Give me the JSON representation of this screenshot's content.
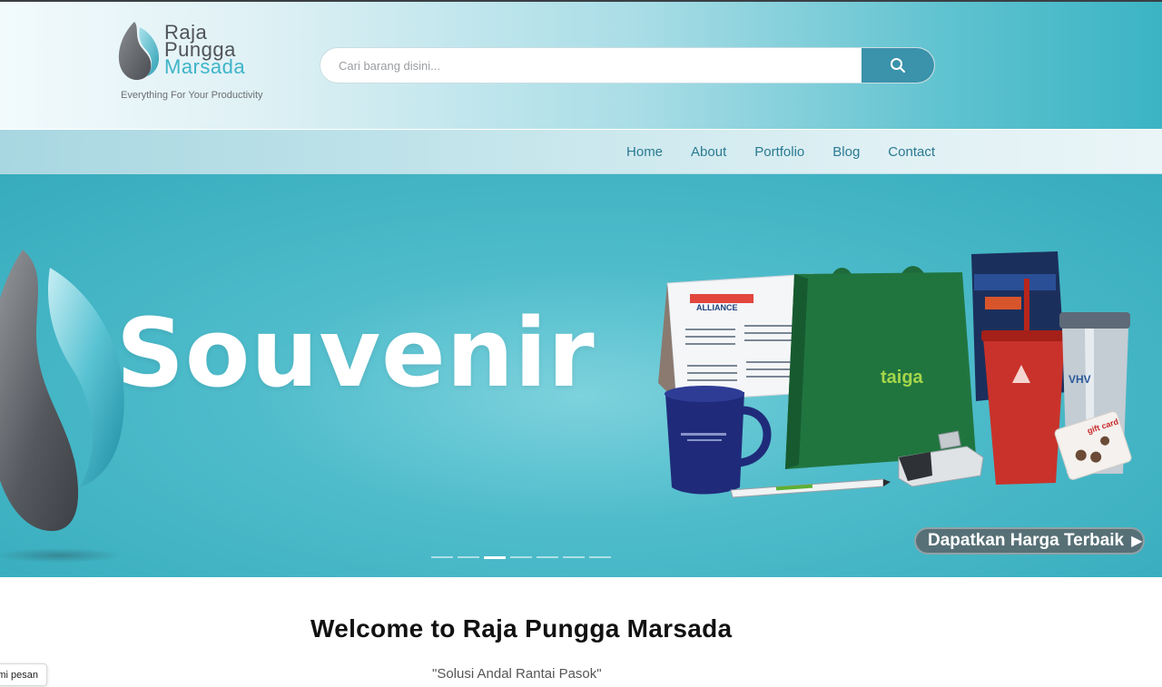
{
  "header": {
    "logo": {
      "line1": "Raja",
      "line2": "Pungga",
      "line3": "Marsada",
      "tagline": "Everything For Your Productivity"
    },
    "search": {
      "placeholder": "Cari barang disini...",
      "button_icon": "search-icon"
    }
  },
  "nav": {
    "items": [
      "Home",
      "About",
      "Portfolio",
      "Blog",
      "Contact"
    ]
  },
  "hero": {
    "title": "Souvenir",
    "cta_label": "Dapatkan Harga Terbaik",
    "slide_count": 7,
    "active_slide": 3,
    "products": {
      "calendar_brand": "ALLIANCE",
      "bag_brand": "taiga",
      "tumbler_brand": "VHV",
      "card_text": "gift card"
    }
  },
  "content": {
    "welcome": "Welcome to Raja Pungga Marsada",
    "motto": "\"Solusi Andal Rantai Pasok\""
  },
  "chat": {
    "label": "mi pesan"
  },
  "colors": {
    "accent": "#3db4c8",
    "search_button": "#3a92ab",
    "nav_text": "#2b7a92",
    "hero_bg": "#36acbd"
  }
}
